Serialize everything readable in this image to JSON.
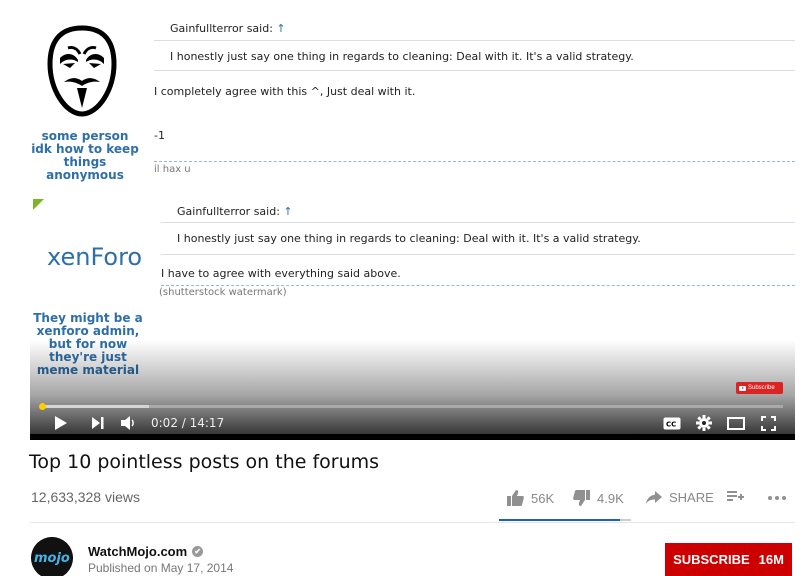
{
  "video_frame": {
    "post1": {
      "quote_author": "Gainfullterror said:",
      "quote_arrow": "↑",
      "quote_text": "I honestly just say one thing in regards to cleaning: Deal with it. It's a valid strategy.",
      "reply_text": "I completely agree with this ^, Just deal with it.",
      "reply_text_2": "-1",
      "signature": "il hax u",
      "annotation": "some person idk how to keep things anonymous"
    },
    "post2": {
      "logo_text": "xenForo",
      "quote_author": "Gainfullterror said:",
      "quote_arrow": "↑",
      "quote_text": "I honestly just say one thing in regards to cleaning: Deal with it. It's a valid strategy.",
      "reply_text": "I have to agree with everything said above.",
      "signature": "(shutterstock watermark)",
      "annotation": "They might be a xenforo admin, but for now they're just meme material"
    },
    "annotation_color": "#2e6fa8",
    "subscribe_badge": "Subscribe"
  },
  "player": {
    "current_time": "0:02",
    "duration": "14:17",
    "time_display": "0:02 / 14:17",
    "progress_fraction": 0.0023,
    "buffer_fraction": 0.145,
    "icons": [
      "play-icon",
      "next-icon",
      "volume-icon",
      "captions-icon",
      "settings-icon",
      "theater-icon",
      "fullscreen-icon"
    ]
  },
  "video_info": {
    "title": "Top 10 pointless posts on the forums",
    "views": "12,633,328 views",
    "likes": "56K",
    "dislikes": "4.9K",
    "share_label": "SHARE",
    "like_fraction": 0.92,
    "accent_color": "#1c62b9"
  },
  "channel": {
    "avatar_text": "mojo",
    "name": "WatchMojo.com",
    "verified_mark": "✔",
    "published": "Published on May 17, 2014",
    "subscribe_label": "SUBSCRIBE",
    "subscriber_count": "16M",
    "subscribe_color": "#cc0000"
  }
}
